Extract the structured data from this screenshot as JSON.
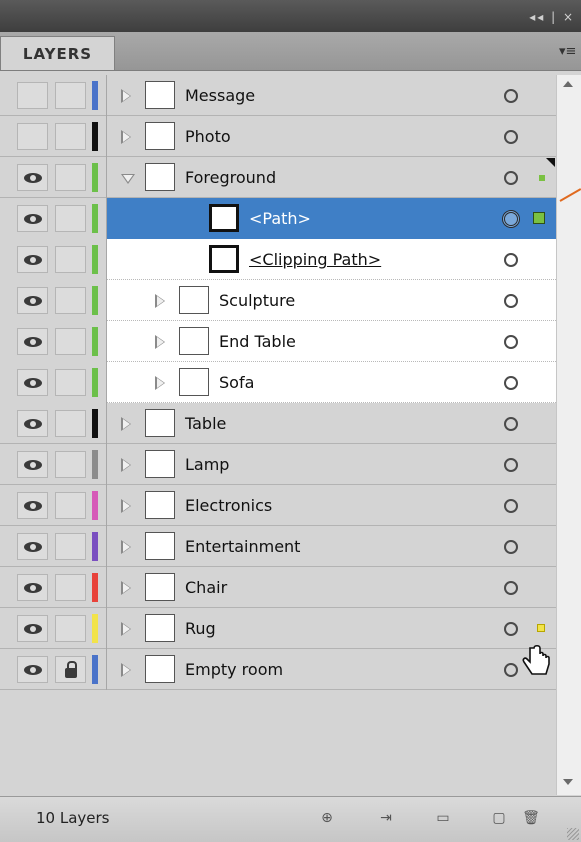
{
  "window": {
    "controls": "◂◂ | ×"
  },
  "panel": {
    "tab_label": "LAYERS",
    "menu_icon": "panel-menu-icon"
  },
  "layers": [
    {
      "name": "Message",
      "color": "#4a73c9",
      "visible": false,
      "locked": false,
      "expanded": false,
      "level": 0
    },
    {
      "name": "Photo",
      "color": "#111111",
      "visible": false,
      "locked": false,
      "expanded": false,
      "level": 0
    },
    {
      "name": "Foreground",
      "color": "#6cc04a",
      "visible": true,
      "locked": false,
      "expanded": true,
      "level": 0
    },
    {
      "name": "<Path>",
      "color": "#6cc04a",
      "visible": true,
      "locked": false,
      "level": 1,
      "selected": true
    },
    {
      "name": "<Clipping Path>",
      "color": "#6cc04a",
      "visible": true,
      "locked": false,
      "level": 1
    },
    {
      "name": "Sculpture",
      "color": "#6cc04a",
      "visible": true,
      "locked": false,
      "level": 1
    },
    {
      "name": "End Table",
      "color": "#6cc04a",
      "visible": true,
      "locked": false,
      "level": 1
    },
    {
      "name": "Sofa",
      "color": "#6cc04a",
      "visible": true,
      "locked": false,
      "level": 1
    },
    {
      "name": "Table",
      "color": "#111111",
      "visible": true,
      "locked": false,
      "level": 0
    },
    {
      "name": "Lamp",
      "color": "#8c8c8c",
      "visible": true,
      "locked": false,
      "level": 0
    },
    {
      "name": "Electronics",
      "color": "#d65ab8",
      "visible": true,
      "locked": false,
      "level": 0
    },
    {
      "name": "Entertainment",
      "color": "#7a4fc0",
      "visible": true,
      "locked": false,
      "level": 0
    },
    {
      "name": "Chair",
      "color": "#e8423a",
      "visible": true,
      "locked": false,
      "level": 0
    },
    {
      "name": "Rug",
      "color": "#f2e34a",
      "visible": true,
      "locked": false,
      "level": 0
    },
    {
      "name": "Empty room",
      "color": "#4a73c9",
      "visible": true,
      "locked": true,
      "level": 0
    }
  ],
  "footer": {
    "layer_count": "10 Layers"
  }
}
